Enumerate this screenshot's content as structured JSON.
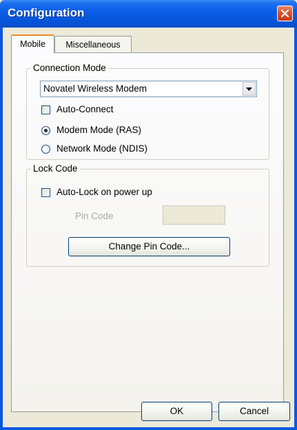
{
  "window": {
    "title": "Configuration"
  },
  "tabs": [
    {
      "label": "Mobile"
    },
    {
      "label": "Miscellaneous"
    }
  ],
  "connection_mode": {
    "label": "Connection Mode",
    "modem_select": {
      "value": "Novatel Wireless Modem"
    },
    "auto_connect": {
      "label": "Auto-Connect",
      "checked": false
    },
    "modem_mode": {
      "label": "Modem Mode (RAS)",
      "selected": true
    },
    "network_mode": {
      "label": "Network Mode (NDIS)",
      "selected": false
    }
  },
  "lock_code": {
    "label": "Lock Code",
    "auto_lock": {
      "label": "Auto-Lock on power up",
      "checked": false
    },
    "pin_code_label": "Pin Code",
    "pin_code_value": "",
    "change_pin_button": "Change Pin Code..."
  },
  "footer": {
    "ok_label": "OK",
    "cancel_label": "Cancel"
  }
}
